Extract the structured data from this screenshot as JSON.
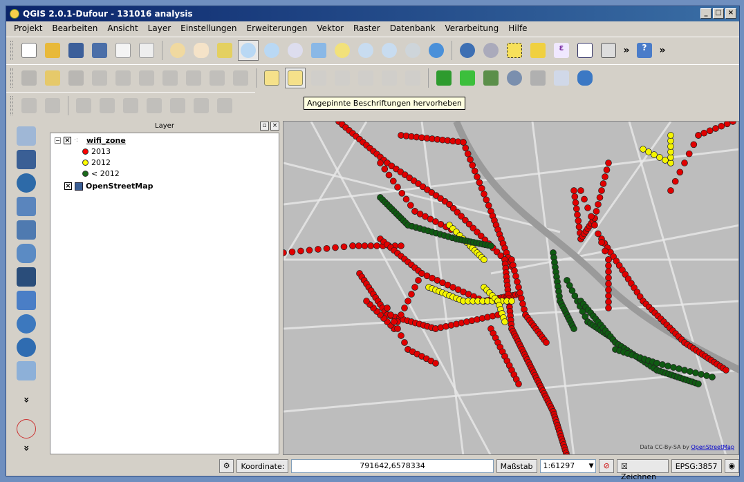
{
  "window": {
    "title": "QGIS 2.0.1-Dufour - 131016 analysis",
    "controls": [
      "_",
      "□",
      "×"
    ]
  },
  "menu": [
    "Projekt",
    "Bearbeiten",
    "Ansicht",
    "Layer",
    "Einstellungen",
    "Erweiterungen",
    "Vektor",
    "Raster",
    "Datenbank",
    "Verarbeitung",
    "Hilfe"
  ],
  "toolbar": {
    "overflow": "»",
    "tooltip": "Angepinnte Beschriftungen hervorheben"
  },
  "layer_panel": {
    "title": "Layer",
    "restore_btn": "▫",
    "close_btn": "×",
    "layers": [
      {
        "name": "wifi_zone",
        "legend": [
          {
            "label": "2013",
            "color": "#ff0000"
          },
          {
            "label": "2012",
            "color": "#ffff00"
          },
          {
            "label": "< 2012",
            "color": "#1b6b1b"
          }
        ]
      },
      {
        "name": "OpenStreetMap"
      }
    ]
  },
  "left_tools": {
    "more": "»"
  },
  "map": {
    "attribution_prefix": "Data ",
    "attribution_license": "CC-By-SA by",
    "attribution_link": "OpenStreetMap"
  },
  "statusbar": {
    "coord_label": "Koordinate:",
    "coord_value": "791642,6578334",
    "scale_label": "Maßstab",
    "scale_value": "1:61297",
    "render_label": "Zeichnen",
    "crs": "EPSG:3857"
  }
}
